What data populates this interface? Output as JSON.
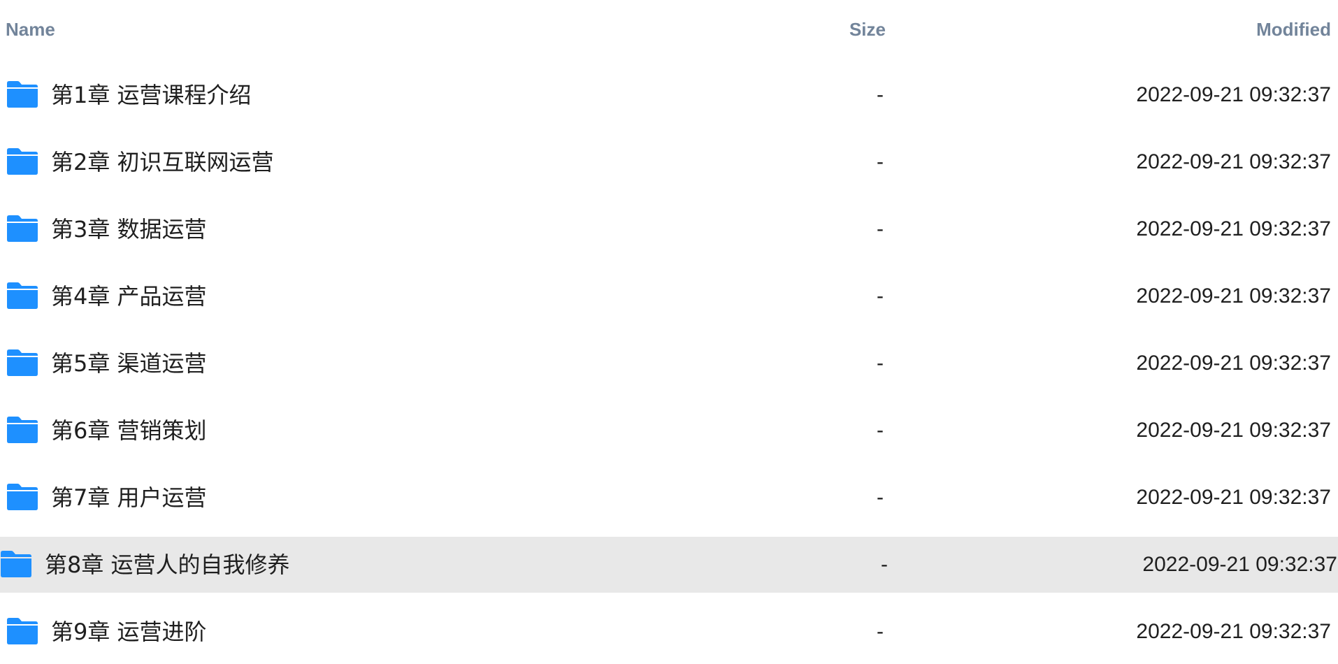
{
  "header": {
    "name_label": "Name",
    "size_label": "Size",
    "modified_label": "Modified"
  },
  "colors": {
    "folder": "#1e90ff",
    "header_text": "#72849a",
    "hover_row": "#e8e8e8"
  },
  "rows": [
    {
      "icon": "folder-icon",
      "name": "第1章 运营课程介绍",
      "size": "-",
      "modified": "2022-09-21 09:32:37"
    },
    {
      "icon": "folder-icon",
      "name": "第2章 初识互联网运营",
      "size": "-",
      "modified": "2022-09-21 09:32:37"
    },
    {
      "icon": "folder-icon",
      "name": "第3章 数据运营",
      "size": "-",
      "modified": "2022-09-21 09:32:37"
    },
    {
      "icon": "folder-icon",
      "name": "第4章 产品运营",
      "size": "-",
      "modified": "2022-09-21 09:32:37"
    },
    {
      "icon": "folder-icon",
      "name": "第5章 渠道运营",
      "size": "-",
      "modified": "2022-09-21 09:32:37"
    },
    {
      "icon": "folder-icon",
      "name": "第6章 营销策划",
      "size": "-",
      "modified": "2022-09-21 09:32:37"
    },
    {
      "icon": "folder-icon",
      "name": "第7章 用户运营",
      "size": "-",
      "modified": "2022-09-21 09:32:37"
    },
    {
      "icon": "folder-icon",
      "name": "第8章 运营人的自我修养",
      "size": "-",
      "modified": "2022-09-21 09:32:37",
      "hovered": true
    },
    {
      "icon": "folder-icon",
      "name": "第9章 运营进阶",
      "size": "-",
      "modified": "2022-09-21 09:32:37"
    }
  ]
}
